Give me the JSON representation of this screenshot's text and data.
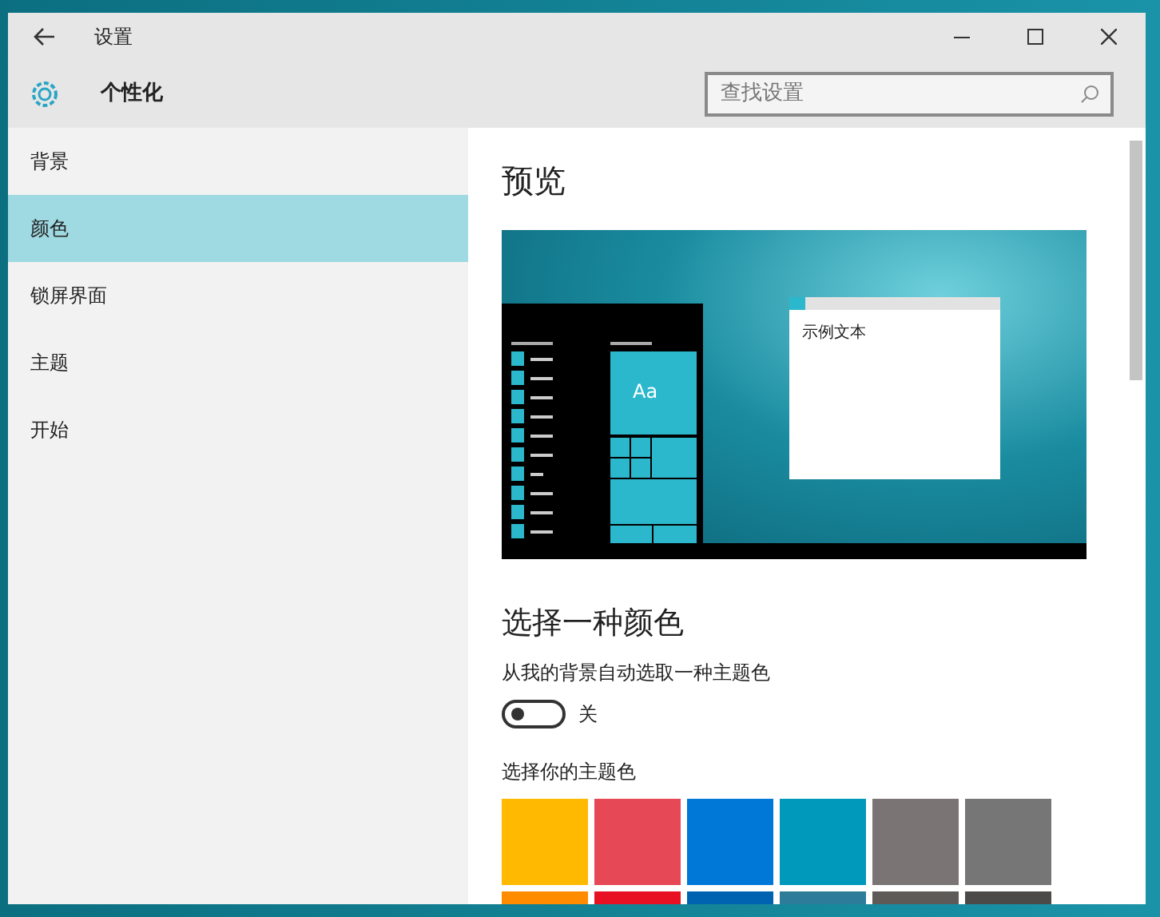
{
  "window": {
    "title": "设置"
  },
  "header": {
    "title": "个性化",
    "search": {
      "placeholder": "查找设置"
    }
  },
  "sidebar": {
    "items": [
      {
        "label": "背景",
        "selected": false
      },
      {
        "label": "颜色",
        "selected": true
      },
      {
        "label": "锁屏界面",
        "selected": false
      },
      {
        "label": "主题",
        "selected": false
      },
      {
        "label": "开始",
        "selected": false
      }
    ]
  },
  "preview": {
    "heading": "预览",
    "tile_text": "Aa",
    "sample_text": "示例文本"
  },
  "color_section": {
    "heading": "选择一种颜色",
    "auto_label": "从我的背景自动选取一种主题色",
    "toggle": {
      "on": false,
      "state_label": "关"
    },
    "accent_label": "选择你的主题色",
    "swatches": [
      {
        "color": "#ffb900"
      },
      {
        "color": "#e74856"
      },
      {
        "color": "#0078d7"
      },
      {
        "color": "#0099bc"
      },
      {
        "color": "#7a7574"
      },
      {
        "color": "#767676"
      },
      {
        "color": "#ff8c00"
      },
      {
        "color": "#e81123"
      },
      {
        "color": "#0063b1"
      },
      {
        "color": "#2d7d9a"
      },
      {
        "color": "#5d5a58"
      },
      {
        "color": "#4c4a48"
      }
    ]
  }
}
